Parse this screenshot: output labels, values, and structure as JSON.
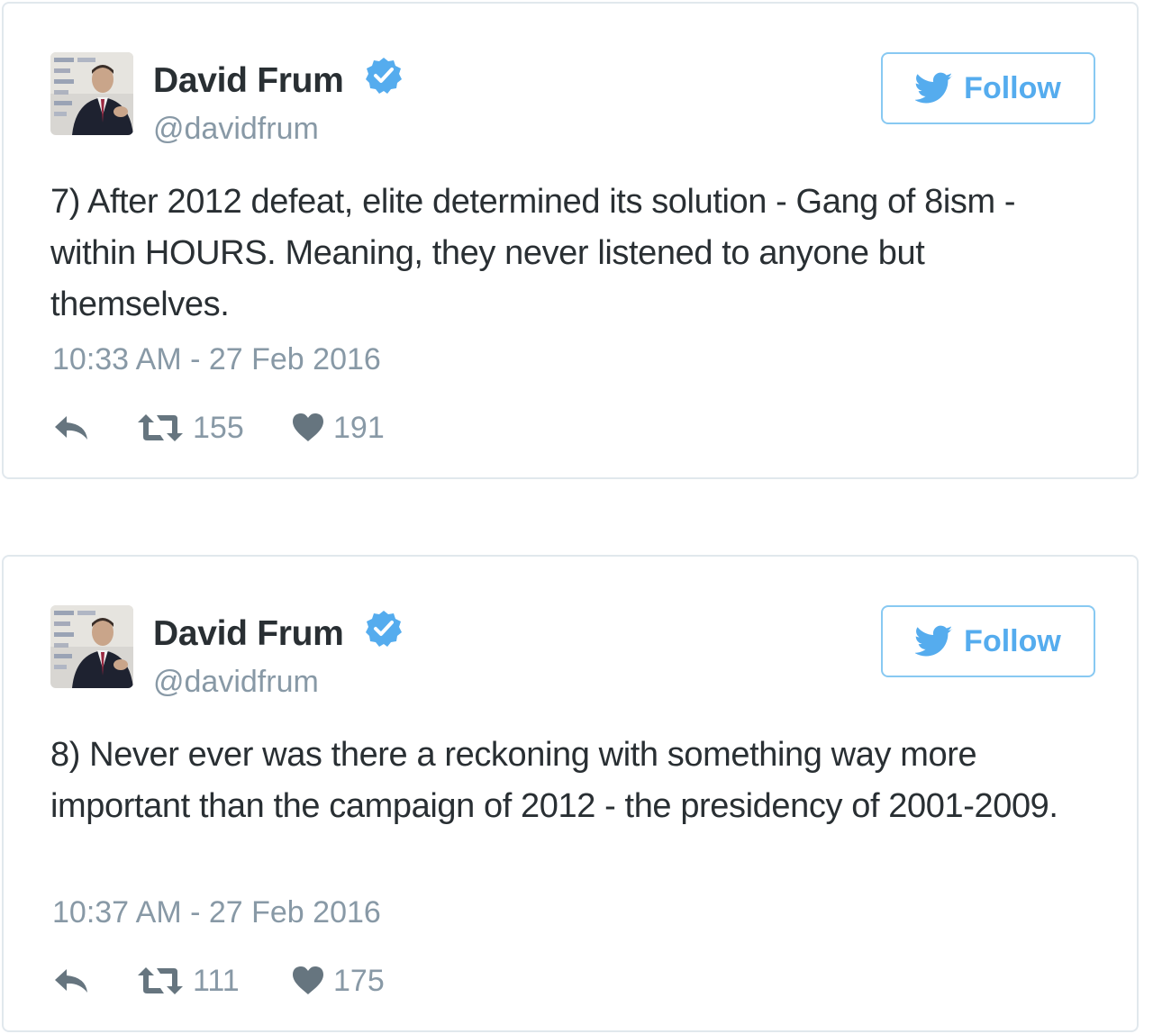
{
  "tweets": [
    {
      "author": {
        "name": "David Frum",
        "handle": "@davidfrum",
        "verified": true
      },
      "follow_label": "Follow",
      "text": "7) After 2012 defeat, elite determined its solution - Gang of 8ism - within HOURS. Meaning, they never listened to anyone but themselves.",
      "timestamp": "10:33 AM - 27 Feb 2016",
      "retweets": "155",
      "likes": "191"
    },
    {
      "author": {
        "name": "David Frum",
        "handle": "@davidfrum",
        "verified": true
      },
      "follow_label": "Follow",
      "text": "8) Never ever was there a reckoning with something way more important than the campaign of 2012 - the presidency of 2001-2009.",
      "timestamp": "10:37 AM - 27 Feb 2016",
      "retweets": "111",
      "likes": "175"
    }
  ],
  "icons": {
    "reply": "reply-icon",
    "retweet": "retweet-icon",
    "like": "heart-icon",
    "verified": "verified-badge-icon",
    "follow": "twitter-bird-icon"
  },
  "colors": {
    "brand": "#55acee",
    "follow_border": "#88c9f2",
    "text": "#292f33",
    "muted": "#8899a6",
    "card_border": "#e1e8ed"
  }
}
